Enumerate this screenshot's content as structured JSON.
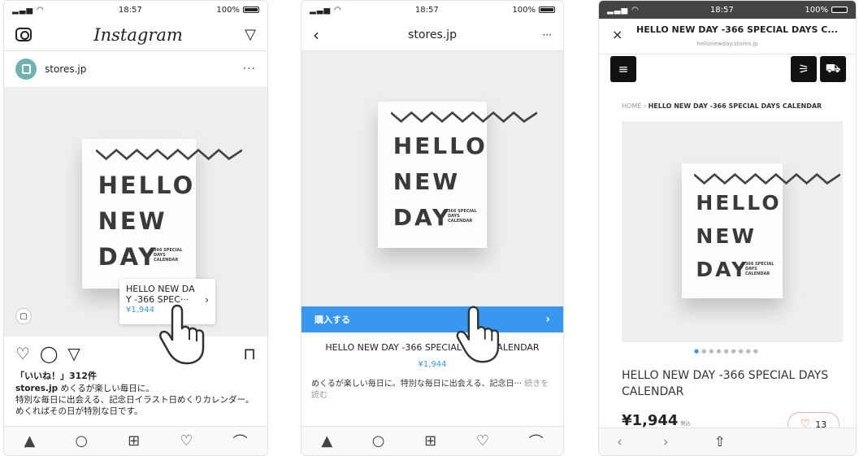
{
  "status": {
    "time": "18:57",
    "battery": "100%"
  },
  "screen1": {
    "app_title": "Instagram",
    "camera_icon": "camera-icon",
    "send_icon": "send-icon",
    "username": "stores.jp",
    "more": "···",
    "calendar": {
      "line1": "HELLO",
      "line2": "NEW",
      "line3": "DAY",
      "subtitle": "366 SPECIAL DAYS CALENDAR"
    },
    "product_tag": {
      "line1": "HELLO NEW DA",
      "line2": "Y -366 SPEC···",
      "price": "¥1,944",
      "chevron": "›"
    },
    "likes": "「いいね！」312件",
    "caption_user": "stores.jp",
    "caption_text": "めくるが楽しい毎日に。",
    "caption_line2": "特別な毎日に出会える、記念日イラスト日めくりカレンダー。",
    "caption_line3": "めくればその日が特別な日です。",
    "tabs": [
      "home",
      "search",
      "add",
      "activity",
      "profile"
    ]
  },
  "screen2": {
    "title": "stores.jp",
    "back": "‹",
    "more": "···",
    "buy_label": "購入する",
    "buy_chevron": "›",
    "product_title": "HELLO NEW DAY -366 SPECIAL DAYS CALENDAR",
    "price": "¥1,944",
    "description": "めくるが楽しい毎日に。特別な毎日に出会える、記念日···",
    "read_more": "続きを読む"
  },
  "screen3": {
    "close": "×",
    "title": "HELLO NEW DAY -366 SPECIAL DAYS C...",
    "url": "hellonewday.stores.jp",
    "breadcrumb_home": "HOME",
    "breadcrumb_sep": "›",
    "breadcrumb_current": "HELLO NEW DAY -366 SPECIAL DAYS CALENDAR",
    "product_title": "HELLO NEW DAY -366 SPECIAL DAYS CALENDAR",
    "price": "¥1,944",
    "tax": "税込",
    "like_count": "13",
    "dots_total": 9,
    "dots_active": 0
  }
}
